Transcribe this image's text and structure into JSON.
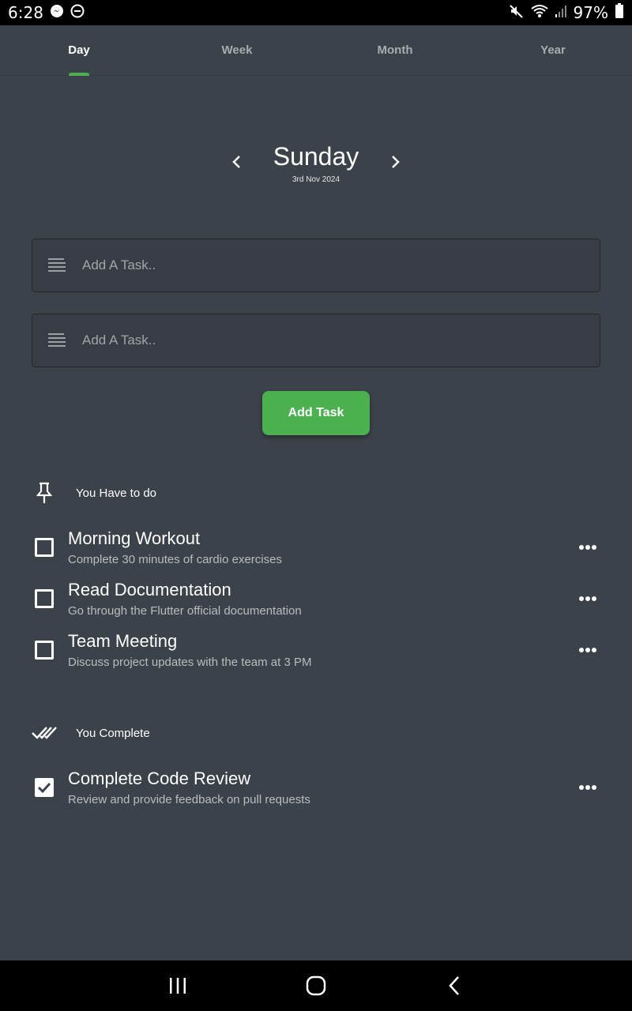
{
  "status_bar": {
    "time": "6:28",
    "battery": "97%",
    "icons": [
      "messenger-icon",
      "do-not-disturb-icon",
      "mute-icon",
      "wifi-icon",
      "signal-icon",
      "battery-icon"
    ]
  },
  "tabs": [
    {
      "label": "Day",
      "active": true
    },
    {
      "label": "Week",
      "active": false
    },
    {
      "label": "Month",
      "active": false
    },
    {
      "label": "Year",
      "active": false
    }
  ],
  "day": {
    "name": "Sunday",
    "date": "3rd Nov 2024"
  },
  "inputs": [
    {
      "placeholder": "Add A Task..",
      "icon": "notes-icon"
    },
    {
      "placeholder": "Add A Task..",
      "icon": "notes-icon"
    }
  ],
  "add_button": {
    "label": "Add Task"
  },
  "todo_section": {
    "label": "You Have to do",
    "icon": "pin-icon",
    "tasks": [
      {
        "title": "Morning Workout",
        "description": "Complete 30 minutes of cardio exercises",
        "done": false
      },
      {
        "title": "Read Documentation",
        "description": "Go through the Flutter official documentation",
        "done": false
      },
      {
        "title": "Team Meeting",
        "description": "Discuss project updates with the team at 3 PM",
        "done": false
      }
    ]
  },
  "complete_section": {
    "label": "You Complete",
    "icon": "done-all-icon",
    "tasks": [
      {
        "title": "Complete Code Review",
        "description": "Review and provide feedback on pull requests",
        "done": true
      }
    ]
  },
  "colors": {
    "background": "#3c424a",
    "accent": "#4caf50",
    "input_bg": "#383d45"
  }
}
